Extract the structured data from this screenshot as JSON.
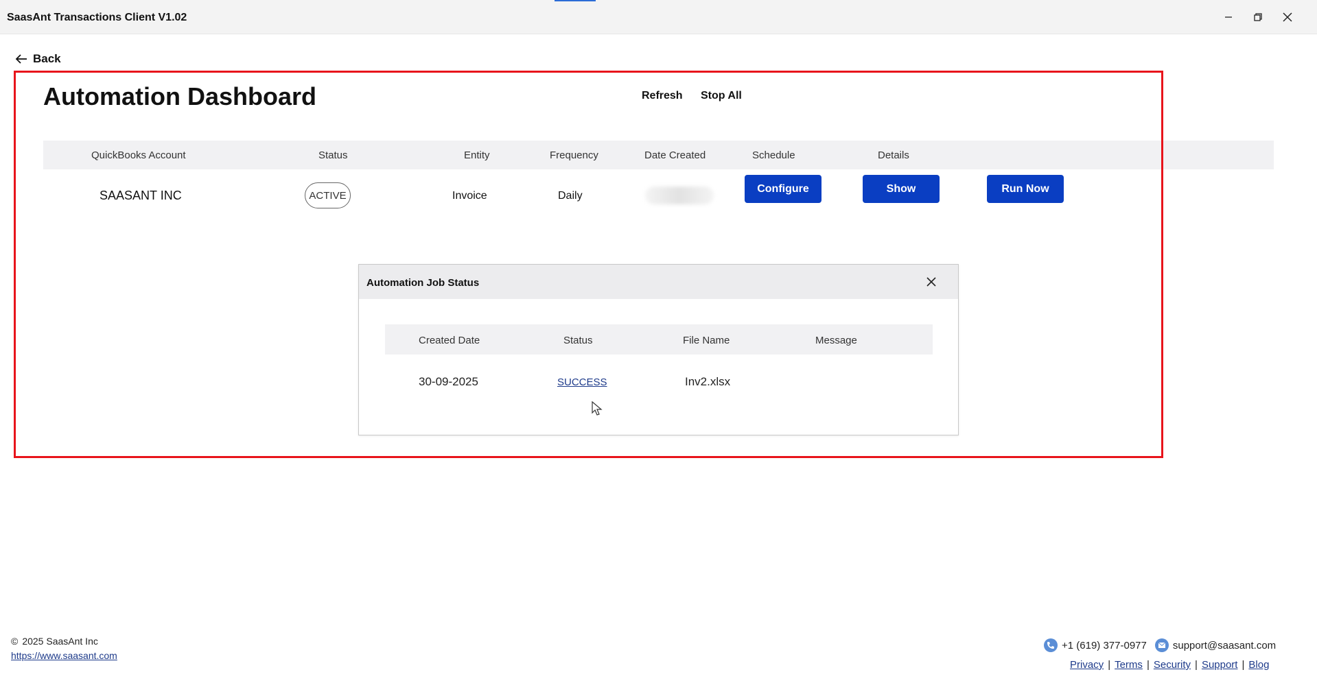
{
  "window": {
    "title": "SaasAnt Transactions Client V1.02"
  },
  "nav": {
    "back_label": "Back"
  },
  "dashboard": {
    "title": "Automation Dashboard",
    "refresh_label": "Refresh",
    "stop_all_label": "Stop All",
    "columns": [
      "QuickBooks Account",
      "Status",
      "Entity",
      "Frequency",
      "Date Created",
      "Schedule",
      "Details"
    ],
    "row": {
      "account": "SAASANT INC",
      "status": "ACTIVE",
      "entity": "Invoice",
      "frequency": "Daily",
      "configure_label": "Configure",
      "show_label": "Show",
      "run_now_label": "Run Now"
    }
  },
  "modal": {
    "title": "Automation Job Status",
    "columns": [
      "Created Date",
      "Status",
      "File Name",
      "Message"
    ],
    "row": {
      "created_date": "30-09-2025",
      "status": "SUCCESS",
      "file_name": "Inv2.xlsx",
      "message": ""
    }
  },
  "footer": {
    "copyright_symbol": "©",
    "copyright_text": "2025  SaasAnt Inc",
    "website": "https://www.saasant.com",
    "phone": "+1 (619) 377-0977",
    "email": "support@saasant.com",
    "links": [
      "Privacy",
      "Terms",
      "Security",
      "Support",
      "Blog"
    ]
  },
  "colors": {
    "primary_button": "#0a3ec2",
    "highlight_frame": "#e8141b",
    "link": "#1d3a8a"
  }
}
